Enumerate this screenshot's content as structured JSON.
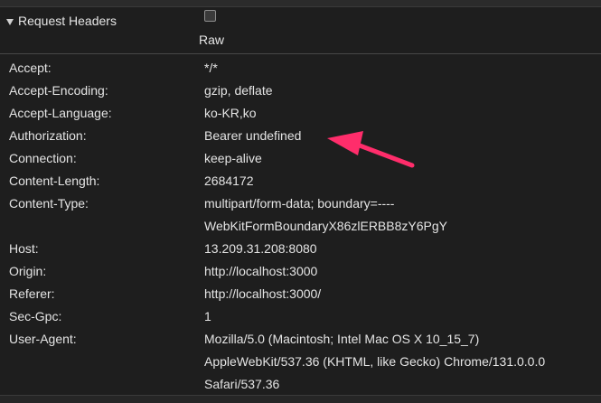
{
  "section": {
    "title": "Request Headers",
    "raw_label": "Raw"
  },
  "headers": [
    {
      "name": "Accept:",
      "value": [
        "*/*"
      ]
    },
    {
      "name": "Accept-Encoding:",
      "value": [
        "gzip, deflate"
      ]
    },
    {
      "name": "Accept-Language:",
      "value": [
        "ko-KR,ko"
      ]
    },
    {
      "name": "Authorization:",
      "value": [
        "Bearer undefined"
      ]
    },
    {
      "name": "Connection:",
      "value": [
        "keep-alive"
      ]
    },
    {
      "name": "Content-Length:",
      "value": [
        "2684172"
      ]
    },
    {
      "name": "Content-Type:",
      "value": [
        "multipart/form-data; boundary=----",
        "WebKitFormBoundaryX86zlERBB8zY6PgY"
      ]
    },
    {
      "name": "Host:",
      "value": [
        "13.209.31.208:8080"
      ]
    },
    {
      "name": "Origin:",
      "value": [
        "http://localhost:3000"
      ]
    },
    {
      "name": "Referer:",
      "value": [
        "http://localhost:3000/"
      ]
    },
    {
      "name": "Sec-Gpc:",
      "value": [
        "1"
      ]
    },
    {
      "name": "User-Agent:",
      "value": [
        "Mozilla/5.0 (Macintosh; Intel Mac OS X 10_15_7)",
        "AppleWebKit/537.36 (KHTML, like Gecko) Chrome/131.0.0.0",
        "Safari/537.36"
      ]
    }
  ],
  "colors": {
    "background": "#1e1e1e",
    "text": "#e4e4e4",
    "annotation_arrow": "#ff2d6b"
  },
  "icons": {
    "collapse": "triangle-down-icon",
    "annotation": "arrow-icon"
  }
}
